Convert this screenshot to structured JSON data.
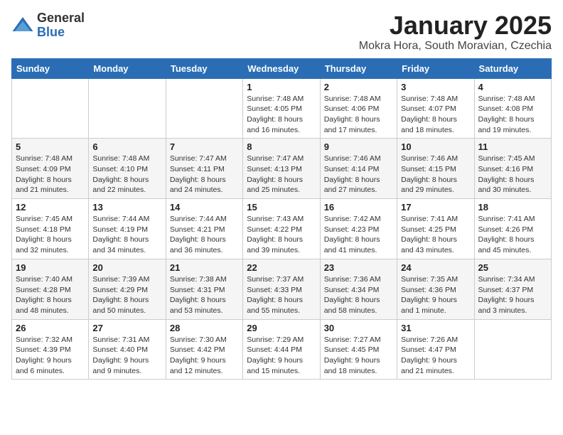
{
  "logo": {
    "general": "General",
    "blue": "Blue"
  },
  "title": "January 2025",
  "location": "Mokra Hora, South Moravian, Czechia",
  "weekdays": [
    "Sunday",
    "Monday",
    "Tuesday",
    "Wednesday",
    "Thursday",
    "Friday",
    "Saturday"
  ],
  "weeks": [
    [
      {
        "day": "",
        "info": ""
      },
      {
        "day": "",
        "info": ""
      },
      {
        "day": "",
        "info": ""
      },
      {
        "day": "1",
        "info": "Sunrise: 7:48 AM\nSunset: 4:05 PM\nDaylight: 8 hours and 16 minutes."
      },
      {
        "day": "2",
        "info": "Sunrise: 7:48 AM\nSunset: 4:06 PM\nDaylight: 8 hours and 17 minutes."
      },
      {
        "day": "3",
        "info": "Sunrise: 7:48 AM\nSunset: 4:07 PM\nDaylight: 8 hours and 18 minutes."
      },
      {
        "day": "4",
        "info": "Sunrise: 7:48 AM\nSunset: 4:08 PM\nDaylight: 8 hours and 19 minutes."
      }
    ],
    [
      {
        "day": "5",
        "info": "Sunrise: 7:48 AM\nSunset: 4:09 PM\nDaylight: 8 hours and 21 minutes."
      },
      {
        "day": "6",
        "info": "Sunrise: 7:48 AM\nSunset: 4:10 PM\nDaylight: 8 hours and 22 minutes."
      },
      {
        "day": "7",
        "info": "Sunrise: 7:47 AM\nSunset: 4:11 PM\nDaylight: 8 hours and 24 minutes."
      },
      {
        "day": "8",
        "info": "Sunrise: 7:47 AM\nSunset: 4:13 PM\nDaylight: 8 hours and 25 minutes."
      },
      {
        "day": "9",
        "info": "Sunrise: 7:46 AM\nSunset: 4:14 PM\nDaylight: 8 hours and 27 minutes."
      },
      {
        "day": "10",
        "info": "Sunrise: 7:46 AM\nSunset: 4:15 PM\nDaylight: 8 hours and 29 minutes."
      },
      {
        "day": "11",
        "info": "Sunrise: 7:45 AM\nSunset: 4:16 PM\nDaylight: 8 hours and 30 minutes."
      }
    ],
    [
      {
        "day": "12",
        "info": "Sunrise: 7:45 AM\nSunset: 4:18 PM\nDaylight: 8 hours and 32 minutes."
      },
      {
        "day": "13",
        "info": "Sunrise: 7:44 AM\nSunset: 4:19 PM\nDaylight: 8 hours and 34 minutes."
      },
      {
        "day": "14",
        "info": "Sunrise: 7:44 AM\nSunset: 4:21 PM\nDaylight: 8 hours and 36 minutes."
      },
      {
        "day": "15",
        "info": "Sunrise: 7:43 AM\nSunset: 4:22 PM\nDaylight: 8 hours and 39 minutes."
      },
      {
        "day": "16",
        "info": "Sunrise: 7:42 AM\nSunset: 4:23 PM\nDaylight: 8 hours and 41 minutes."
      },
      {
        "day": "17",
        "info": "Sunrise: 7:41 AM\nSunset: 4:25 PM\nDaylight: 8 hours and 43 minutes."
      },
      {
        "day": "18",
        "info": "Sunrise: 7:41 AM\nSunset: 4:26 PM\nDaylight: 8 hours and 45 minutes."
      }
    ],
    [
      {
        "day": "19",
        "info": "Sunrise: 7:40 AM\nSunset: 4:28 PM\nDaylight: 8 hours and 48 minutes."
      },
      {
        "day": "20",
        "info": "Sunrise: 7:39 AM\nSunset: 4:29 PM\nDaylight: 8 hours and 50 minutes."
      },
      {
        "day": "21",
        "info": "Sunrise: 7:38 AM\nSunset: 4:31 PM\nDaylight: 8 hours and 53 minutes."
      },
      {
        "day": "22",
        "info": "Sunrise: 7:37 AM\nSunset: 4:33 PM\nDaylight: 8 hours and 55 minutes."
      },
      {
        "day": "23",
        "info": "Sunrise: 7:36 AM\nSunset: 4:34 PM\nDaylight: 8 hours and 58 minutes."
      },
      {
        "day": "24",
        "info": "Sunrise: 7:35 AM\nSunset: 4:36 PM\nDaylight: 9 hours and 1 minute."
      },
      {
        "day": "25",
        "info": "Sunrise: 7:34 AM\nSunset: 4:37 PM\nDaylight: 9 hours and 3 minutes."
      }
    ],
    [
      {
        "day": "26",
        "info": "Sunrise: 7:32 AM\nSunset: 4:39 PM\nDaylight: 9 hours and 6 minutes."
      },
      {
        "day": "27",
        "info": "Sunrise: 7:31 AM\nSunset: 4:40 PM\nDaylight: 9 hours and 9 minutes."
      },
      {
        "day": "28",
        "info": "Sunrise: 7:30 AM\nSunset: 4:42 PM\nDaylight: 9 hours and 12 minutes."
      },
      {
        "day": "29",
        "info": "Sunrise: 7:29 AM\nSunset: 4:44 PM\nDaylight: 9 hours and 15 minutes."
      },
      {
        "day": "30",
        "info": "Sunrise: 7:27 AM\nSunset: 4:45 PM\nDaylight: 9 hours and 18 minutes."
      },
      {
        "day": "31",
        "info": "Sunrise: 7:26 AM\nSunset: 4:47 PM\nDaylight: 9 hours and 21 minutes."
      },
      {
        "day": "",
        "info": ""
      }
    ]
  ]
}
